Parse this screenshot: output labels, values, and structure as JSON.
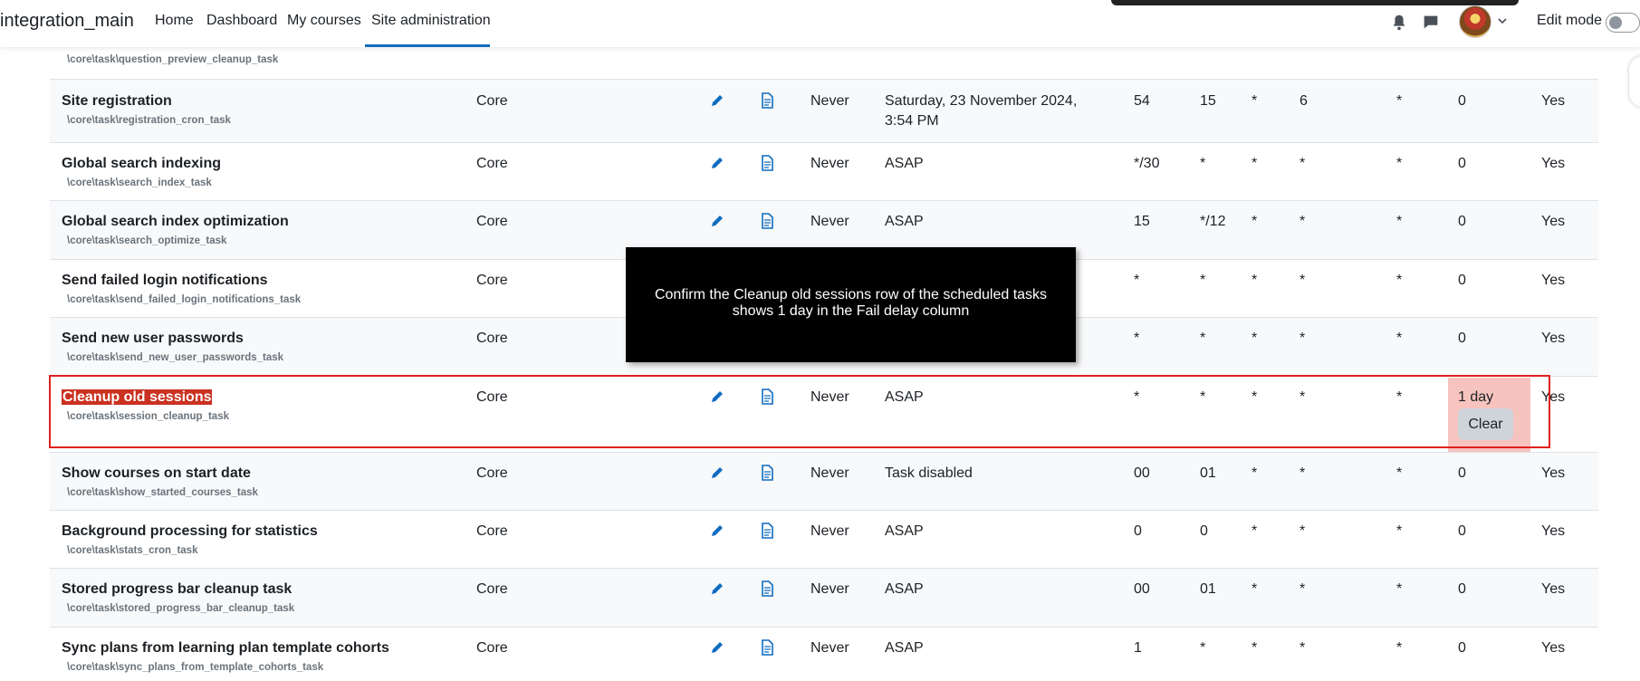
{
  "navbar": {
    "brand": "integration_main",
    "links": [
      "Home",
      "Dashboard",
      "My courses",
      "Site administration"
    ],
    "edit_mode_label": "Edit mode"
  },
  "overlay": {
    "text": "Confirm the Cleanup old sessions row of the scheduled tasks shows 1 day in the Fail delay column"
  },
  "clear_label": "Clear",
  "partial_row": {
    "class": "\\core\\task\\question_preview_cleanup_task"
  },
  "rows": [
    {
      "name": "Site registration",
      "class": "\\core\\task\\registration_cron_task",
      "component": "Core",
      "last_run": "Never",
      "next_run": "Saturday, 23 November 2024, 3:54 PM",
      "minute": "54",
      "hour": "15",
      "day": "*",
      "day_of_week": "6",
      "month": "*",
      "fail_delay": "0",
      "default": "Yes"
    },
    {
      "name": "Global search indexing",
      "class": "\\core\\task\\search_index_task",
      "component": "Core",
      "last_run": "Never",
      "next_run": "ASAP",
      "minute": "*/30",
      "hour": "*",
      "day": "*",
      "day_of_week": "*",
      "month": "*",
      "fail_delay": "0",
      "default": "Yes"
    },
    {
      "name": "Global search index optimization",
      "class": "\\core\\task\\search_optimize_task",
      "component": "Core",
      "last_run": "Never",
      "next_run": "ASAP",
      "minute": "15",
      "hour": "*/12",
      "day": "*",
      "day_of_week": "*",
      "month": "*",
      "fail_delay": "0",
      "default": "Yes"
    },
    {
      "name": "Send failed login notifications",
      "class": "\\core\\task\\send_failed_login_notifications_task",
      "component": "Core",
      "last_run": "",
      "next_run": "",
      "minute": "*",
      "hour": "*",
      "day": "*",
      "day_of_week": "*",
      "month": "*",
      "fail_delay": "0",
      "default": "Yes"
    },
    {
      "name": "Send new user passwords",
      "class": "\\core\\task\\send_new_user_passwords_task",
      "component": "Core",
      "last_run": "",
      "next_run": "",
      "minute": "*",
      "hour": "*",
      "day": "*",
      "day_of_week": "*",
      "month": "*",
      "fail_delay": "0",
      "default": "Yes"
    },
    {
      "name": "Cleanup old sessions",
      "class": "\\core\\task\\session_cleanup_task",
      "component": "Core",
      "last_run": "Never",
      "next_run": "ASAP",
      "minute": "*",
      "hour": "*",
      "day": "*",
      "day_of_week": "*",
      "month": "*",
      "fail_delay": "1 day",
      "default": "Yes"
    },
    {
      "name": "Show courses on start date",
      "class": "\\core\\task\\show_started_courses_task",
      "component": "Core",
      "last_run": "Never",
      "next_run": "Task disabled",
      "minute": "00",
      "hour": "01",
      "day": "*",
      "day_of_week": "*",
      "month": "*",
      "fail_delay": "0",
      "default": "Yes"
    },
    {
      "name": "Background processing for statistics",
      "class": "\\core\\task\\stats_cron_task",
      "component": "Core",
      "last_run": "Never",
      "next_run": "ASAP",
      "minute": "0",
      "hour": "0",
      "day": "*",
      "day_of_week": "*",
      "month": "*",
      "fail_delay": "0",
      "default": "Yes"
    },
    {
      "name": "Stored progress bar cleanup task",
      "class": "\\core\\task\\stored_progress_bar_cleanup_task",
      "component": "Core",
      "last_run": "Never",
      "next_run": "ASAP",
      "minute": "00",
      "hour": "01",
      "day": "*",
      "day_of_week": "*",
      "month": "*",
      "fail_delay": "0",
      "default": "Yes"
    },
    {
      "name": "Sync plans from learning plan template cohorts",
      "class": "\\core\\task\\sync_plans_from_template_cohorts_task",
      "component": "Core",
      "last_run": "Never",
      "next_run": "ASAP",
      "minute": "1",
      "hour": "*",
      "day": "*",
      "day_of_week": "*",
      "month": "*",
      "fail_delay": "0",
      "default": "Yes"
    }
  ],
  "colors": {
    "accent": "#0f6cbf",
    "highlight": "#ca3120",
    "frame": "#e02020"
  }
}
